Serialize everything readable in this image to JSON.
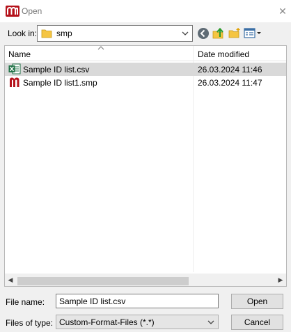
{
  "window": {
    "title": "Open",
    "close_glyph": "✕"
  },
  "lookin": {
    "label": "Look in:",
    "value": "smp"
  },
  "list": {
    "columns": {
      "name": "Name",
      "date_modified": "Date modified"
    },
    "rows": [
      {
        "name": "Sample ID list.csv",
        "date": "26.03.2024 11:46",
        "icon": "excel-csv-icon",
        "selected": true
      },
      {
        "name": "Sample ID list1.smp",
        "date": "26.03.2024 11:47",
        "icon": "app-file-icon",
        "selected": false
      }
    ]
  },
  "scroll": {
    "left_glyph": "◀",
    "right_glyph": "▶"
  },
  "filename": {
    "label": "File name:",
    "value": "Sample ID list.csv"
  },
  "filetype": {
    "label": "Files of type:",
    "value": "Custom-Format-Files (*.*)"
  },
  "buttons": {
    "open": "Open",
    "cancel": "Cancel"
  },
  "colors": {
    "brand": "#b5121b",
    "excel": "#1d7044",
    "folder": "#f5c542",
    "selection": "#d9d9d9"
  }
}
